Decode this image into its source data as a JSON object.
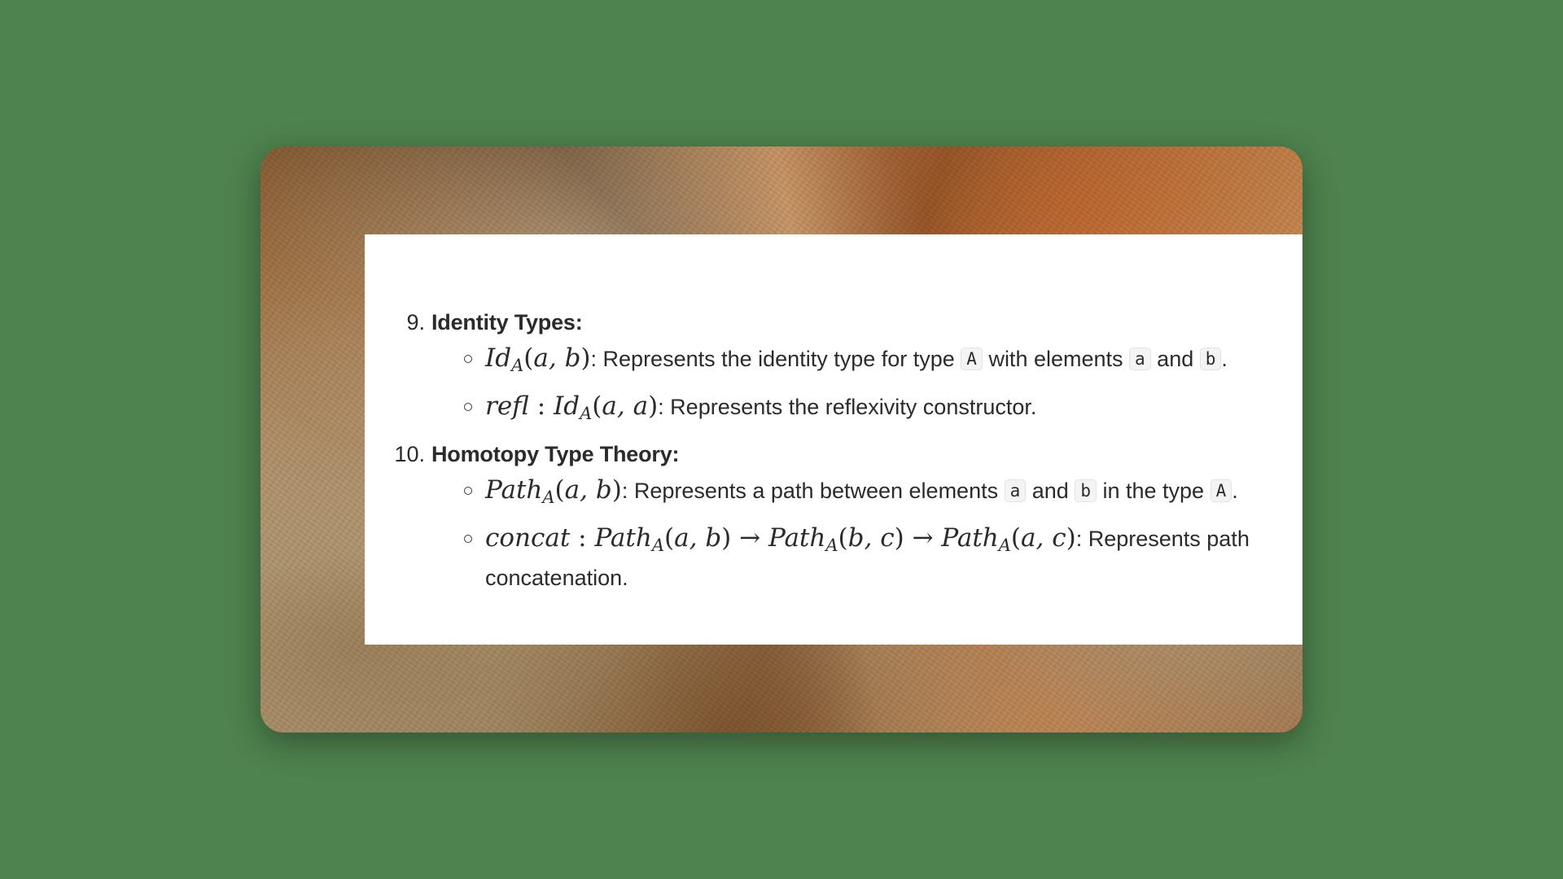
{
  "list": [
    {
      "number": "9.",
      "heading": "Identity Types:",
      "items": [
        {
          "math": "Id_A(a, b)",
          "text_1": ": Represents the identity type for type ",
          "code_1": "A",
          "text_2": " with elements ",
          "code_2": "a",
          "text_3": " and ",
          "code_3": "b",
          "text_4": "."
        },
        {
          "math": "refl : Id_A(a, a)",
          "text_1": ": Represents the reflexivity constructor."
        }
      ]
    },
    {
      "number": "10.",
      "heading": "Homotopy Type Theory:",
      "items": [
        {
          "math": "Path_A(a, b)",
          "text_1": ": Represents a path between elements ",
          "code_1": "a",
          "text_2": " and ",
          "code_2": "b",
          "text_3": " in the type ",
          "code_3": "A",
          "text_4": "."
        },
        {
          "math": "concat : Path_A(a, b) → Path_A(b, c) → Path_A(a, c)",
          "text_1": ": Represents path concatenation."
        }
      ]
    }
  ]
}
